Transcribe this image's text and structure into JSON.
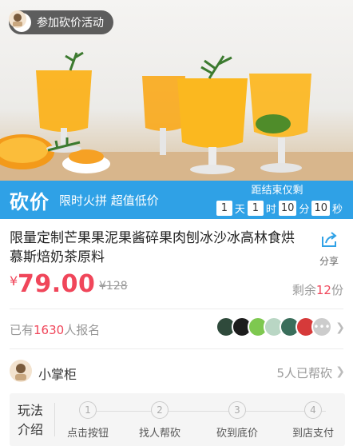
{
  "hero": {
    "join_label": "参加砍价活动"
  },
  "promo": {
    "title": "砍价",
    "subtitle": "限时火拼 超值低价",
    "countdown_label": "距结束仅剩",
    "countdown": [
      {
        "value": "1",
        "unit": "天"
      },
      {
        "value": "1",
        "unit": "时"
      },
      {
        "value": "10",
        "unit": "分"
      },
      {
        "value": "10",
        "unit": "秒"
      }
    ]
  },
  "product": {
    "title": "限量定制芒果果泥果酱碎果肉刨冰沙冰高林食烘慕斯焙奶茶原料",
    "share_label": "分享",
    "currency": "¥",
    "price": "79.00",
    "original_price": "¥128",
    "stock_prefix": "剩余",
    "stock_count": "12",
    "stock_suffix": "份"
  },
  "signup": {
    "prefix": "已有",
    "count": "1630",
    "suffix": "人报名",
    "more": "•••"
  },
  "seller": {
    "name": "小掌柜",
    "helped": "5人已帮砍"
  },
  "rules": {
    "label": "玩法介绍",
    "steps": [
      {
        "num": "1",
        "label": "点击按钮"
      },
      {
        "num": "2",
        "label": "找人帮砍"
      },
      {
        "num": "3",
        "label": "砍到底价"
      },
      {
        "num": "4",
        "label": "到店支付"
      }
    ]
  },
  "colors": {
    "accent_blue": "#2fa1e6",
    "price_red": "#f0465a"
  },
  "icons": [
    "share-icon",
    "chevron-right-icon",
    "avatar-icon"
  ]
}
